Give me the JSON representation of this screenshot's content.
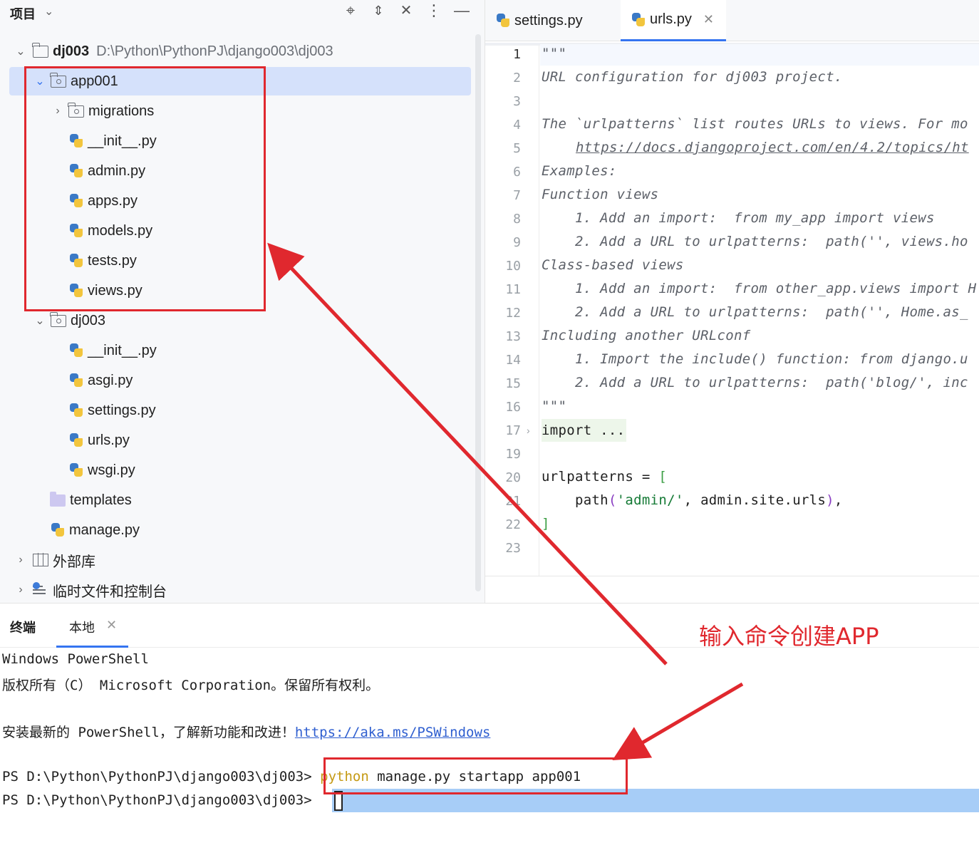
{
  "project_panel": {
    "title": "项目",
    "tree": {
      "root_name": "dj003",
      "root_path": "D:\\Python\\PythonPJ\\django003\\dj003",
      "app_folder": "app001",
      "migrations": "migrations",
      "app_files": [
        "__init__.py",
        "admin.py",
        "apps.py",
        "models.py",
        "tests.py",
        "views.py"
      ],
      "project_folder": "dj003",
      "project_files": [
        "__init__.py",
        "asgi.py",
        "settings.py",
        "urls.py",
        "wsgi.py"
      ],
      "templates": "templates",
      "manage": "manage.py",
      "external_libs": "外部库",
      "scratches": "临时文件和控制台"
    }
  },
  "editor": {
    "tabs": [
      {
        "label": "settings.py",
        "active": false
      },
      {
        "label": "urls.py",
        "active": true
      }
    ],
    "line_numbers": [
      "1",
      "2",
      "3",
      "4",
      "5",
      "6",
      "7",
      "8",
      "9",
      "10",
      "11",
      "12",
      "13",
      "14",
      "15",
      "16",
      "17",
      "19",
      "20",
      "21",
      "22",
      "23"
    ],
    "lines": {
      "l1": "\"\"\"",
      "l2": "URL configuration for dj003 project.",
      "l4": "The `urlpatterns` list routes URLs to views. For mo",
      "l5": "https://docs.djangoproject.com/en/4.2/topics/ht",
      "l6": "Examples:",
      "l7": "Function views",
      "l8": "    1. Add an import:  from my_app import views",
      "l9": "    2. Add a URL to urlpatterns:  path('', views.ho",
      "l10": "Class-based views",
      "l11": "    1. Add an import:  from other_app.views import H",
      "l12": "    2. Add a URL to urlpatterns:  path('', Home.as_",
      "l13": "Including another URLconf",
      "l14": "    1. Import the include() function: from django.u",
      "l15": "    2. Add a URL to urlpatterns:  path('blog/', inc",
      "l16": "\"\"\"",
      "l17": "import ...",
      "l20_a": "urlpatterns = ",
      "l20_b": "[",
      "l21_a": "    path",
      "l21_b": "(",
      "l21_c": "'admin/'",
      "l21_d": ", admin.site.urls",
      "l21_e": ")",
      "l21_f": ",",
      "l22": "]"
    }
  },
  "terminal": {
    "title": "终端",
    "tab_label": "本地",
    "lines": {
      "t1": "Windows PowerShell",
      "t2": "版权所有（C） Microsoft Corporation。保留所有权利。",
      "t3_a": "安装最新的 PowerShell，了解新功能和改进！",
      "t3_link": "https://aka.ms/PSWindows",
      "prompt": "PS D:\\Python\\PythonPJ\\django003\\dj003> ",
      "cmd_keyword": "python",
      "cmd_rest": " manage.py startapp app001"
    }
  },
  "annotation": {
    "label": "输入命令创建APP",
    "color": "#e0282e"
  }
}
